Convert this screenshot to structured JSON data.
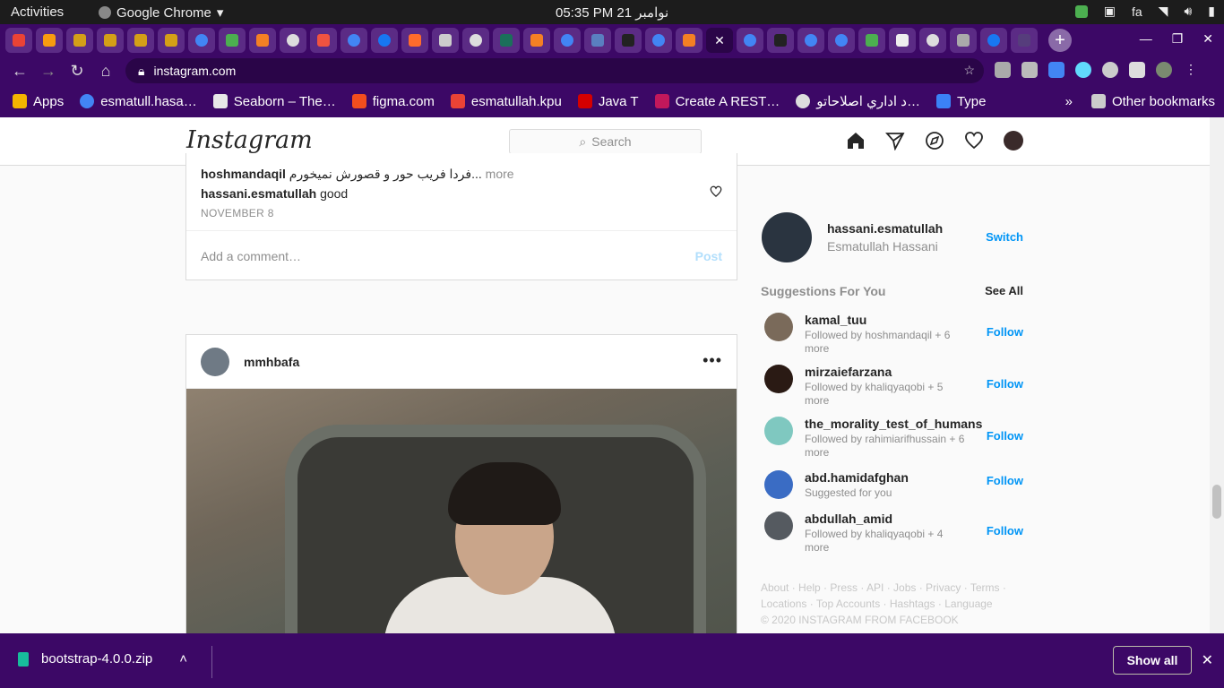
{
  "os": {
    "activities": "Activities",
    "app_name": "Google Chrome",
    "clock": "05:35 PM  21 نوامبر",
    "lang": "fa"
  },
  "browser": {
    "url": "instagram.com",
    "bookmarks": [
      {
        "label": "Apps",
        "color": "#f4b400"
      },
      {
        "label": "esmatull.hasa…",
        "color": "#4285f4"
      },
      {
        "label": "Seaborn – The…",
        "color": "#e8e8e8"
      },
      {
        "label": "figma.com",
        "color": "#f24e1e"
      },
      {
        "label": "esmatullah.kpu",
        "color": "#ea4335"
      },
      {
        "label": "Java T",
        "color": "#d50000"
      },
      {
        "label": "Create A REST…",
        "color": "#c2185b"
      },
      {
        "label": "د اداري اصلاحاتو…",
        "color": "#dddddd"
      },
      {
        "label": "Type",
        "color": "#3b82f6"
      }
    ],
    "bookmarks_overflow": "»",
    "other_bookmarks": "Other bookmarks"
  },
  "instagram": {
    "logo": "Instagram",
    "search_placeholder": "Search",
    "prev_post": {
      "comment1_user": "hoshmandaqil",
      "comment1_text": "فردا فریب حور و قصورش نمیخورم...",
      "comment1_more": "more",
      "comment2_user": "hassani.esmatullah",
      "comment2_text": "good",
      "date": "NOVEMBER 8",
      "add_comment_placeholder": "Add a comment…",
      "post_label": "Post"
    },
    "post": {
      "username": "mmhbafa",
      "more": "•••"
    },
    "profile": {
      "username": "hassani.esmatullah",
      "full_name": "Esmatullah Hassani",
      "switch": "Switch"
    },
    "suggestions_title": "Suggestions For You",
    "see_all": "See All",
    "suggestions": [
      {
        "username": "kamal_tuu",
        "sub": "Followed by hoshmandaqil + 6 more",
        "follow": "Follow",
        "color": "#7a6a5a"
      },
      {
        "username": "mirzaiefarzana",
        "sub": "Followed by khaliqyaqobi + 5 more",
        "follow": "Follow",
        "color": "#2a1a14"
      },
      {
        "username": "the_morality_test_of_humans",
        "sub": "Followed by rahimiarifhussain + 6 more",
        "follow": "Follow",
        "color": "#7fc8c0"
      },
      {
        "username": "abd.hamidafghan",
        "sub": "Suggested for you",
        "follow": "Follow",
        "color": "#3a6cc4"
      },
      {
        "username": "abdullah_amid",
        "sub": "Followed by khaliqyaqobi + 4 more",
        "follow": "Follow",
        "color": "#555a60"
      }
    ],
    "footer_line1": "About · Help · Press · API · Jobs · Privacy · Terms ·",
    "footer_line2": "Locations · Top Accounts · Hashtags · Language",
    "footer_line3": "© 2020 INSTAGRAM FROM FACEBOOK"
  },
  "downloads": {
    "file": "bootstrap-4.0.0.zip",
    "show_all": "Show all"
  }
}
